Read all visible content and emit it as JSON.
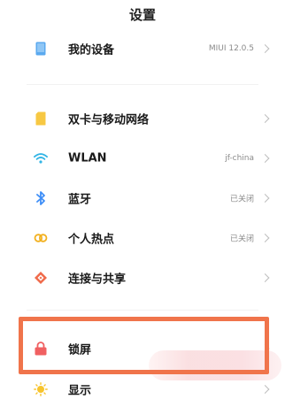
{
  "header": {
    "title": "设置"
  },
  "settings": {
    "my_device": {
      "label": "我的设备",
      "value": "MIUI 12.0.5",
      "icon": "phone-icon",
      "color": "#5aa9ef"
    },
    "dual_sim": {
      "label": "双卡与移动网络",
      "icon": "sim-card-icon",
      "color": "#f7c843"
    },
    "wlan": {
      "label": "WLAN",
      "value": "jf-china",
      "icon": "wifi-icon",
      "color": "#33b5e5"
    },
    "bluetooth": {
      "label": "蓝牙",
      "value": "已关闭",
      "icon": "bluetooth-icon",
      "color": "#3e8ef7"
    },
    "hotspot": {
      "label": "个人热点",
      "value": "已关闭",
      "icon": "hotspot-icon",
      "color": "#f2b01e"
    },
    "connect_share": {
      "label": "连接与共享",
      "icon": "connection-icon",
      "color": "#f06a4a"
    },
    "lock_screen": {
      "label": "锁屏",
      "icon": "lock-icon",
      "color": "#f06061"
    },
    "display": {
      "label": "显示",
      "icon": "sun-icon",
      "color": "#f7c42d"
    }
  },
  "accent_colors": {
    "highlight_border": "#f0744b",
    "chevron": "#bdbdbd"
  }
}
